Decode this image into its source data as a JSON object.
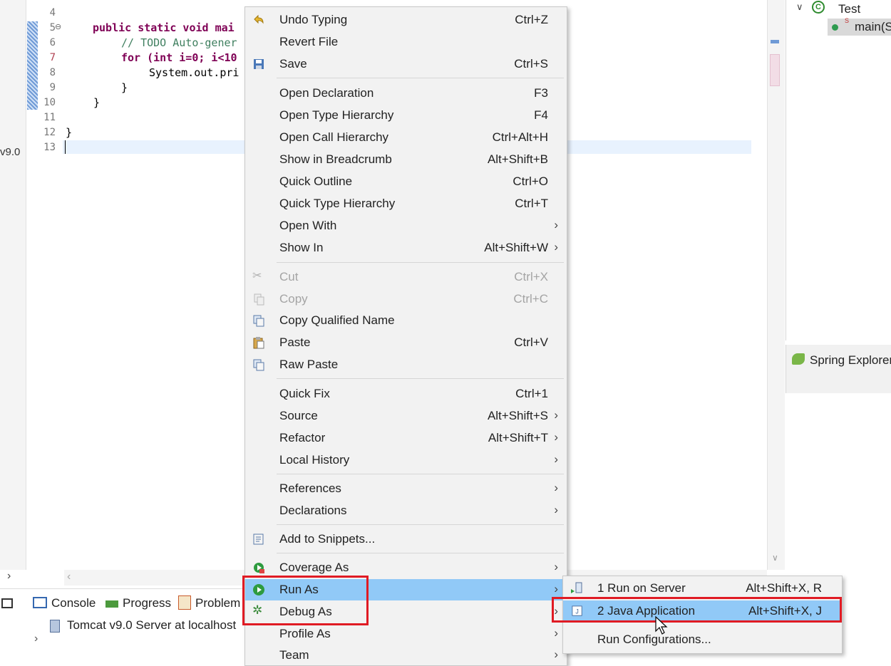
{
  "editor": {
    "lines": [
      {
        "n": "4",
        "code": ""
      },
      {
        "n": "5",
        "code": "public static void mai"
      },
      {
        "n": "6",
        "code": "// TODO Auto-gener"
      },
      {
        "n": "7",
        "code": "for (int i=0; i<10"
      },
      {
        "n": "8",
        "code": "System.out.pri"
      },
      {
        "n": "9",
        "code": "}"
      },
      {
        "n": "10",
        "code": "}"
      },
      {
        "n": "11",
        "code": ""
      },
      {
        "n": "12",
        "code": "}"
      },
      {
        "n": "13",
        "code": ""
      }
    ],
    "left_fragment": "v9.0"
  },
  "outline": {
    "class_name": "Test",
    "method_name": "main(S"
  },
  "spring_explorer": {
    "title": "Spring Explorer"
  },
  "bottom_panel": {
    "tabs": [
      "Console",
      "Progress",
      "Problem"
    ],
    "server_entry": "Tomcat v9.0 Server at localhost"
  },
  "context_menu": {
    "items": [
      {
        "label": "Undo Typing",
        "shortcut": "Ctrl+Z",
        "icon": "undo-icon"
      },
      {
        "label": "Revert File",
        "shortcut": ""
      },
      {
        "label": "Save",
        "shortcut": "Ctrl+S",
        "icon": "save-icon"
      },
      {
        "label": "Open Declaration",
        "shortcut": "F3"
      },
      {
        "label": "Open Type Hierarchy",
        "shortcut": "F4"
      },
      {
        "label": "Open Call Hierarchy",
        "shortcut": "Ctrl+Alt+H"
      },
      {
        "label": "Show in Breadcrumb",
        "shortcut": "Alt+Shift+B"
      },
      {
        "label": "Quick Outline",
        "shortcut": "Ctrl+O"
      },
      {
        "label": "Quick Type Hierarchy",
        "shortcut": "Ctrl+T"
      },
      {
        "label": "Open With",
        "shortcut": ""
      },
      {
        "label": "Show In",
        "shortcut": "Alt+Shift+W"
      },
      {
        "label": "Cut",
        "shortcut": "Ctrl+X",
        "icon": "cut-icon"
      },
      {
        "label": "Copy",
        "shortcut": "Ctrl+C",
        "icon": "copy-icon"
      },
      {
        "label": "Copy Qualified Name",
        "shortcut": "",
        "icon": "copy-qualified-icon"
      },
      {
        "label": "Paste",
        "shortcut": "Ctrl+V",
        "icon": "paste-icon"
      },
      {
        "label": "Raw Paste",
        "shortcut": "",
        "icon": "raw-paste-icon"
      },
      {
        "label": "Quick Fix",
        "shortcut": "Ctrl+1"
      },
      {
        "label": "Source",
        "shortcut": "Alt+Shift+S"
      },
      {
        "label": "Refactor",
        "shortcut": "Alt+Shift+T"
      },
      {
        "label": "Local History",
        "shortcut": ""
      },
      {
        "label": "References",
        "shortcut": ""
      },
      {
        "label": "Declarations",
        "shortcut": ""
      },
      {
        "label": "Add to Snippets...",
        "shortcut": "",
        "icon": "snippets-icon"
      },
      {
        "label": "Coverage As",
        "shortcut": "",
        "icon": "coverage-icon"
      },
      {
        "label": "Run As",
        "shortcut": "",
        "icon": "run-icon"
      },
      {
        "label": "Debug As",
        "shortcut": "",
        "icon": "debug-icon"
      },
      {
        "label": "Profile As",
        "shortcut": ""
      },
      {
        "label": "Team",
        "shortcut": ""
      }
    ]
  },
  "run_as_submenu": {
    "items": [
      {
        "label": "1 Run on Server",
        "shortcut": "Alt+Shift+X, R",
        "icon": "server-icon"
      },
      {
        "label": "2 Java Application",
        "shortcut": "Alt+Shift+X, J",
        "icon": "java-app-icon"
      },
      {
        "label": "Run Configurations...",
        "shortcut": ""
      }
    ]
  },
  "colors": {
    "highlight": "#91c9f7",
    "annotation_box": "#e01b24"
  }
}
